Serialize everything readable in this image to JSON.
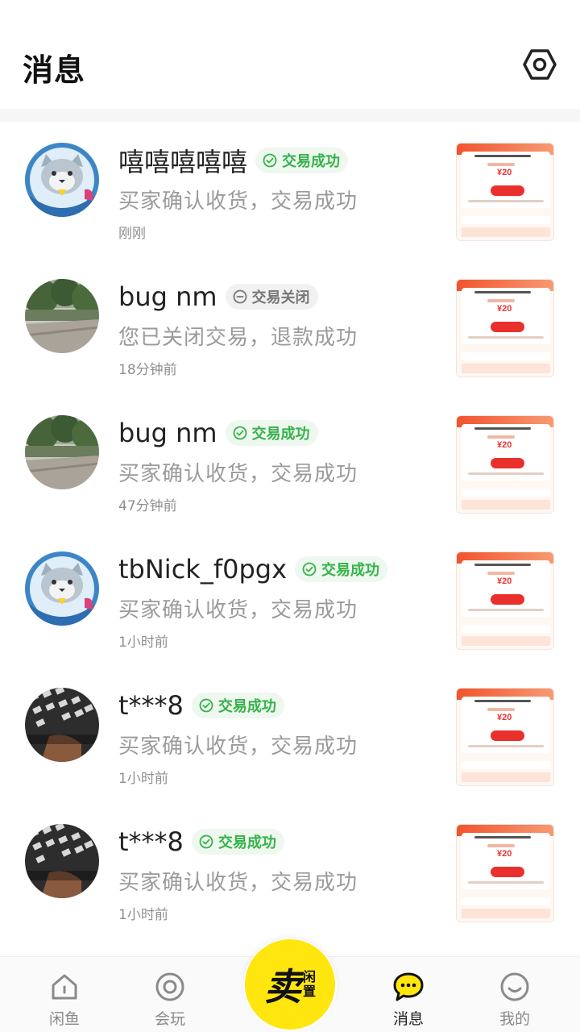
{
  "header": {
    "title": "消息",
    "settings_icon": "settings-hexagon-icon"
  },
  "colors": {
    "success_green": "#36b24a",
    "closed_gray": "#777777",
    "brand_yellow": "#ffe60f"
  },
  "messages": [
    {
      "name": "嘻嘻嘻嘻嘻",
      "status": "交易成功",
      "status_type": "success",
      "text": "买家确认收货，交易成功",
      "time": "刚刚",
      "avatar": "cat-astronaut-avatar"
    },
    {
      "name": "bug nm",
      "status": "交易关闭",
      "status_type": "closed",
      "text": "您已关闭交易，退款成功",
      "time": "18分钟前",
      "avatar": "park-photo-avatar"
    },
    {
      "name": "bug nm",
      "status": "交易成功",
      "status_type": "success",
      "text": "买家确认收货，交易成功",
      "time": "47分钟前",
      "avatar": "park-photo-avatar"
    },
    {
      "name": "tbNick_f0pgx",
      "status": "交易成功",
      "status_type": "success",
      "text": "买家确认收货，交易成功",
      "time": "1小时前",
      "avatar": "cat-astronaut-avatar"
    },
    {
      "name": "t***8",
      "status": "交易成功",
      "status_type": "success",
      "text": "买家确认收货，交易成功",
      "time": "1小时前",
      "avatar": "keyboard-photo-avatar"
    },
    {
      "name": "t***8",
      "status": "交易成功",
      "status_type": "success",
      "text": "买家确认收货，交易成功",
      "time": "1小时前",
      "avatar": "keyboard-photo-avatar"
    }
  ],
  "thumbnail": {
    "price": "¥20"
  },
  "tabbar": {
    "tabs": [
      {
        "label": "闲鱼",
        "icon": "home-icon"
      },
      {
        "label": "会玩",
        "icon": "circle-target-icon"
      },
      {
        "label": "消息",
        "icon": "chat-bubble-icon",
        "active": true
      },
      {
        "label": "我的",
        "icon": "smile-face-icon"
      }
    ],
    "sell": {
      "main": "卖",
      "sub1": "闲",
      "sub2": "置"
    }
  }
}
